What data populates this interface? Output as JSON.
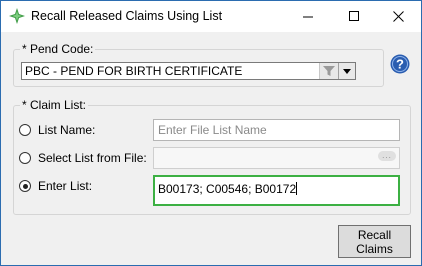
{
  "window": {
    "title": "Recall Released Claims Using List",
    "icon": "green-diamond-icon",
    "controls": {
      "minimize": "minimize-icon",
      "maximize": "maximize-icon",
      "close": "close-icon"
    }
  },
  "pend_code": {
    "legend": "* Pend Code:",
    "selected_value": "PBC - PEND FOR BIRTH CERTIFICATE",
    "filter_icon": "funnel-icon",
    "dropdown_icon": "chevron-down-icon"
  },
  "help": {
    "icon": "question-help-icon",
    "glyph": "?"
  },
  "claim_list": {
    "legend": "* Claim List:",
    "options": {
      "list_name": {
        "label": "List Name:",
        "placeholder": "Enter File List Name",
        "checked": false
      },
      "select_file": {
        "label": "Select List from File:",
        "browse_glyph": "...",
        "checked": false
      },
      "enter_list": {
        "label": "Enter List:",
        "value": "B00173; C00546; B00172",
        "checked": true
      }
    }
  },
  "actions": {
    "recall_label": "Recall Claims"
  },
  "colors": {
    "focus_border": "#3cb043",
    "help_blue": "#2a5db0",
    "accent_green": "#4caf50"
  }
}
